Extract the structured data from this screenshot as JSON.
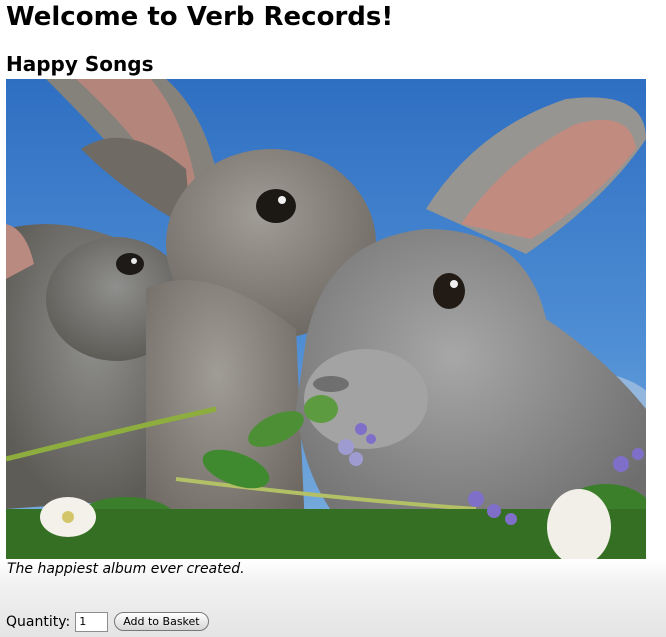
{
  "page": {
    "title": "Welcome to Verb Records!"
  },
  "album": {
    "title": "Happy Songs",
    "caption": "The happiest album ever created."
  },
  "purchase": {
    "quantity_label": "Quantity:",
    "quantity_value": "1",
    "add_button_label": "Add to Basket"
  }
}
